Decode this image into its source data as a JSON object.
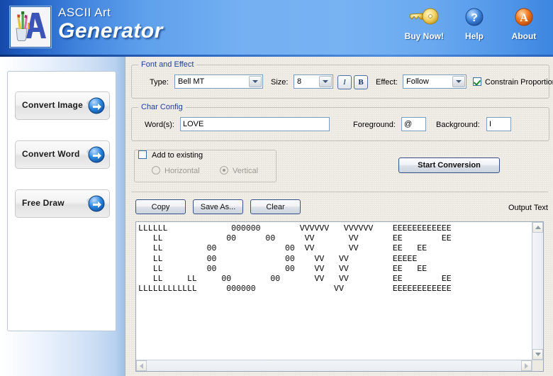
{
  "header": {
    "title_line1": "ASCII Art",
    "title_line2": "Generator",
    "logo_icon": "ascii-art-logo-icon",
    "tools": [
      {
        "label": "Buy Now!",
        "icon": "key-icon"
      },
      {
        "label": "Help",
        "icon": "question-mark-icon"
      },
      {
        "label": "About",
        "icon": "about-a-icon"
      }
    ]
  },
  "sidebar": {
    "buttons": [
      {
        "label": "Convert Image",
        "icon": "blue-arrow-right-icon"
      },
      {
        "label": "Convert Word",
        "icon": "blue-arrow-right-icon"
      },
      {
        "label": "Free Draw",
        "icon": "blue-arrow-right-icon"
      }
    ]
  },
  "font_effect": {
    "legend": "Font and Effect",
    "type_label": "Type:",
    "type_value": "Bell MT",
    "size_label": "Size:",
    "size_value": "8",
    "italic_label": "I",
    "bold_label": "B",
    "effect_label": "Effect:",
    "effect_value": "Follow",
    "constrain_label": "Constrain Proportion",
    "constrain_checked": true
  },
  "char_config": {
    "legend": "Char Config",
    "words_label": "Word(s):",
    "words_value": "LOVE",
    "foreground_label": "Foreground:",
    "foreground_value": "@",
    "background_label": "Background:",
    "background_value": "I"
  },
  "add_existing": {
    "checkbox_label": "Add to existing",
    "checkbox_checked": false,
    "horizontal_label": "Horizontal",
    "horizontal_selected": false,
    "vertical_label": "Vertical",
    "vertical_selected": true,
    "disabled": true
  },
  "actions": {
    "start_conversion": "Start Conversion",
    "copy": "Copy",
    "save_as": "Save As...",
    "clear": "Clear",
    "output_label": "Output Text"
  },
  "output": {
    "ascii_art": "LLLLLL             000000        VVVVVV   VVVVVV    EEEEEEEEEEEE\n   LL             00      00      VV       VV       EE        EE\n   LL         00              00  VV       VV       EE   EE\n   LL         00              00    VV   VV         EEEEE\n   LL         00              00    VV   VV         EE   EE\n   LL     LL     00        00       VV   VV         EE        EE\nLLLLLLLLLLLL      000000                VV          EEEEEEEEEEEE"
  },
  "colors": {
    "header_blue": "#74b0f2",
    "header_dark_blue": "#1449a8",
    "legend_text": "#20409a",
    "accent_arrow": "#1f7fd8",
    "check_green": "#1a8a2a"
  }
}
